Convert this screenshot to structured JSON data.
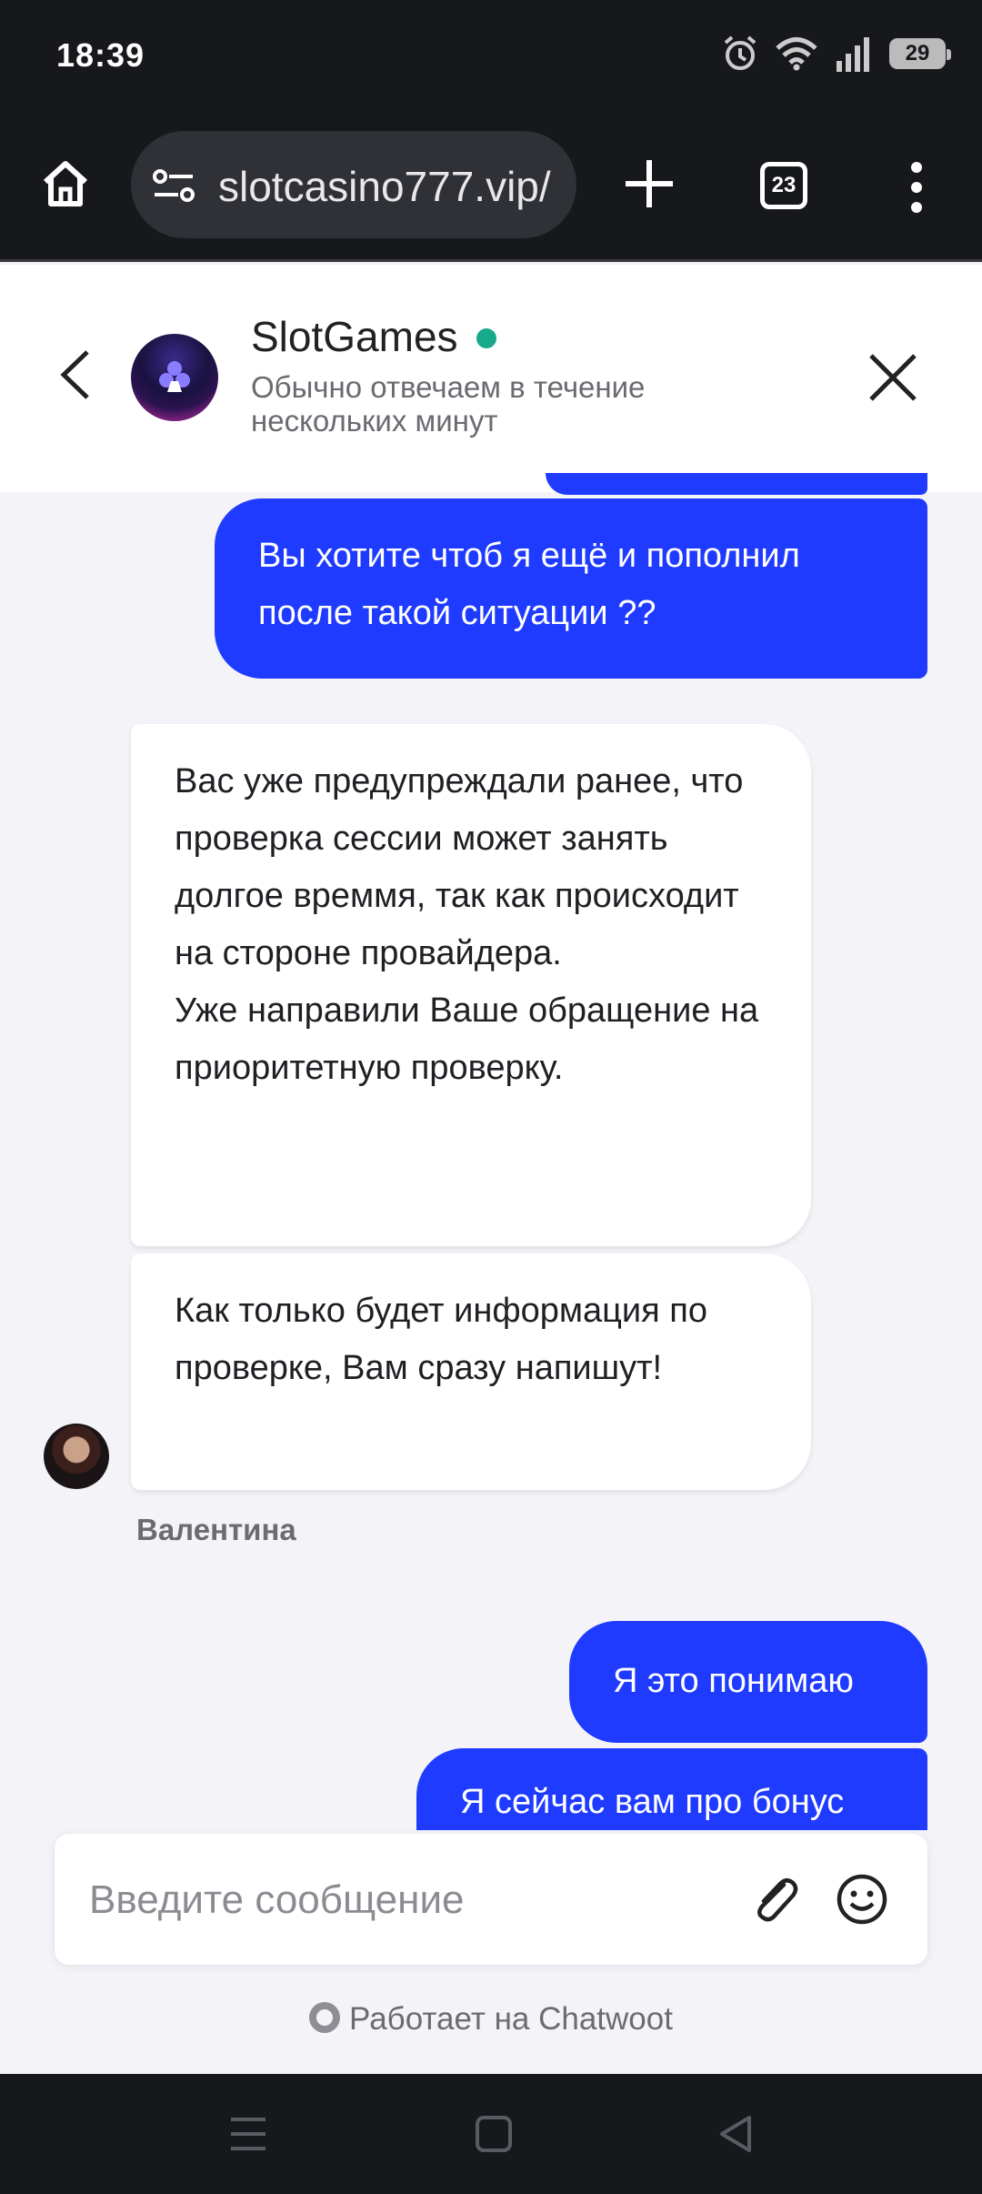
{
  "status_bar": {
    "time": "18:39",
    "battery": "29"
  },
  "browser": {
    "url": "slotcasino777.vip/",
    "tab_count": "23"
  },
  "chat_header": {
    "name": "SlotGames",
    "subtitle": "Обычно отвечаем в течение нескольких минут"
  },
  "messages": [
    {
      "from": "user",
      "text": "Вы хотите чтоб я ещё и пополнил после такой ситуации ??"
    },
    {
      "from": "agent",
      "text": "Вас уже предупреждали ранее, что проверка сессии может занять долгое времмя, так как происходит на стороне провайдера.\nУже направили Ваше обращение на приоритетную проверку."
    },
    {
      "from": "agent",
      "text": "Как только будет информация по проверке, Вам сразу напишут!"
    },
    {
      "from": "user",
      "text": "Я это понимаю"
    },
    {
      "from": "user",
      "text": "Я сейчас вам про бонус"
    }
  ],
  "agent_name": "Валентина",
  "composer": {
    "placeholder": "Введите сообщение"
  },
  "footer": {
    "powered_by": "Работает на Chatwoot"
  },
  "icons": [
    "home-icon",
    "site-settings-icon",
    "new-tab-icon",
    "tab-switcher-icon",
    "more-menu-icon",
    "back-arrow-icon",
    "close-icon",
    "attachment-icon",
    "emoji-icon",
    "recent-apps-icon",
    "home-nav-icon",
    "back-nav-icon",
    "alarm-icon",
    "wifi-icon",
    "signal-icon"
  ],
  "colors": {
    "accent": "#1f3bff",
    "online": "#18a98a",
    "dark_bar": "#17181c",
    "chat_bg": "#f3f3f8"
  }
}
